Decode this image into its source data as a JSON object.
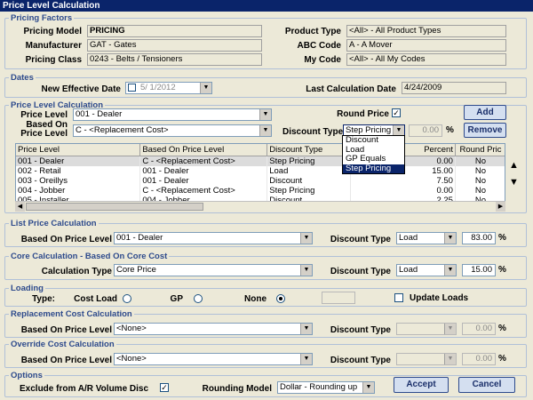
{
  "window": {
    "title": "Price Level Calculation"
  },
  "pricing_factors": {
    "legend": "Pricing Factors",
    "pricing_model_label": "Pricing Model",
    "pricing_model_value": "PRICING",
    "manufacturer_label": "Manufacturer",
    "manufacturer_value": "GAT - Gates",
    "pricing_class_label": "Pricing Class",
    "pricing_class_value": "0243 - Belts / Tensioners",
    "product_type_label": "Product Type",
    "product_type_value": "<All> - All Product Types",
    "abc_code_label": "ABC Code",
    "abc_code_value": "A - A Mover",
    "my_code_label": "My Code",
    "my_code_value": "<All> - All My Codes"
  },
  "dates": {
    "legend": "Dates",
    "new_effective_label": "New Effective Date",
    "new_effective_value": "5/  1/2012",
    "last_calc_label": "Last Calculation Date",
    "last_calc_value": "4/24/2009"
  },
  "plc": {
    "legend": "Price Level Calculation",
    "price_level_label": "Price Level",
    "price_level_value": "001 - Dealer",
    "based_on_label_1": "Based On",
    "based_on_label_2": "Price Level",
    "based_on_value": "C - <Replacement Cost>",
    "round_price_label": "Round Price",
    "round_price_checked": "✓",
    "discount_type_label": "Discount Type",
    "discount_type_value": "Step Pricing",
    "percent_value": "0.00",
    "percent_unit": "%",
    "add_label": "Add",
    "remove_label": "Remove",
    "dropdown_options": [
      "Discount",
      "Load",
      "GP Equals",
      "Step Pricing"
    ],
    "columns": [
      "Price Level",
      "Based On Price Level",
      "Discount Type",
      "Percent",
      "Round Pric"
    ],
    "rows": [
      {
        "level": "001 - Dealer",
        "based": "C - <Replacement Cost>",
        "type": "Step Pricing",
        "percent": "0.00",
        "round": "No"
      },
      {
        "level": "002 - Retail",
        "based": "001 - Dealer",
        "type": "Load",
        "percent": "15.00",
        "round": "No"
      },
      {
        "level": "003 - Oreillys",
        "based": "001 - Dealer",
        "type": "Discount",
        "percent": "7.50",
        "round": "No"
      },
      {
        "level": "004 - Jobber",
        "based": "C - <Replacement Cost>",
        "type": "Step Pricing",
        "percent": "0.00",
        "round": "No"
      },
      {
        "level": "005 - Installer",
        "based": "004 - Jobber",
        "type": "Discount",
        "percent": "2.25",
        "round": "No"
      }
    ]
  },
  "list_price": {
    "legend": "List Price Calculation",
    "based_on_label": "Based On Price Level",
    "based_on_value": "001 - Dealer",
    "discount_type_label": "Discount Type",
    "discount_type_value": "Load",
    "percent_value": "83.00",
    "unit": "%"
  },
  "core": {
    "legend": "Core Calculation - Based On Core Cost",
    "calc_type_label": "Calculation Type",
    "calc_type_value": "Core Price",
    "discount_type_label": "Discount Type",
    "discount_type_value": "Load",
    "percent_value": "15.00",
    "unit": "%"
  },
  "loading": {
    "legend": "Loading",
    "type_label": "Type:",
    "cost_load_label": "Cost Load",
    "gp_label": "GP",
    "none_label": "None",
    "update_loads_label": "Update Loads"
  },
  "replacement": {
    "legend": "Replacement Cost Calculation",
    "based_on_label": "Based On Price Level",
    "based_on_value": "<None>",
    "discount_type_label": "Discount Type",
    "percent_value": "0.00",
    "unit": "%"
  },
  "override": {
    "legend": "Override Cost Calculation",
    "based_on_label": "Based On Price Level",
    "based_on_value": "<None>",
    "discount_type_label": "Discount Type",
    "percent_value": "0.00",
    "unit": "%"
  },
  "options": {
    "legend": "Options",
    "exclude_label": "Exclude from A/R Volume Disc",
    "exclude_checked": "✓",
    "rounding_model_label": "Rounding Model",
    "rounding_model_value": "Dollar - Rounding up",
    "accept_label": "Accept",
    "cancel_label": "Cancel"
  },
  "colors": {
    "title_bar": "#0a246a",
    "window_bg": "#ece9d8",
    "legend_text": "#2d4a8c",
    "selection": "#0a246a"
  }
}
